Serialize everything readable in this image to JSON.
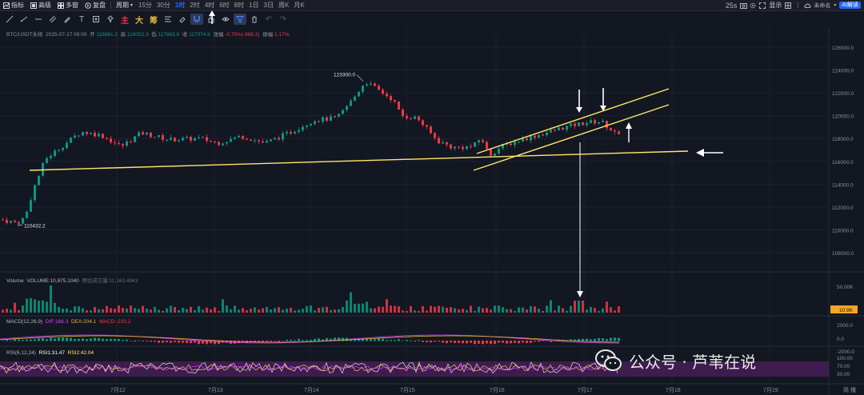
{
  "toolbar": {
    "indicators": "指标",
    "advanced": "高级",
    "multi_chart": "多窗",
    "replay": "复盘",
    "period": "周期",
    "timeframes": [
      "15分",
      "30分",
      "1时",
      "2时",
      "4时",
      "6时",
      "8时",
      "1日",
      "3日",
      "周K",
      "月K"
    ],
    "active_timeframe_index": 2,
    "countdown": "25s",
    "display": "显示",
    "user": "未命名",
    "ai_button": "AI解读"
  },
  "drawing_tools": {
    "cn_main": "主",
    "cn_big": "大",
    "cn_chip": "筹"
  },
  "main_legend": {
    "symbol": "BTC/USDT永续",
    "datetime": "2025-07-17 09:00",
    "open_label": "开",
    "open": "118861.2",
    "high_label": "高",
    "high": "119052.3",
    "low_label": "低",
    "low": "117863.6",
    "close_label": "收",
    "close": "117974.9",
    "change_label": "涨幅",
    "change": "-0.75%(-886.3)",
    "amplitude_label": "振幅",
    "amplitude": "1.17%"
  },
  "volume_legend": {
    "label": "Volume",
    "value": "VOLUME:10,875.1040",
    "ma_label": "预估成交量:11,163.4943",
    "axis_label": "50.00K",
    "current_badge": "10.9K"
  },
  "macd_legend": {
    "label": "MACD(12,26,9)",
    "dif": "DIF:166.3",
    "dea": "DEA:204.1",
    "macd": "MACD:-230.2",
    "axis": [
      "2000.0",
      "0.0",
      "-2000.0"
    ]
  },
  "rsi_legend": {
    "label": "RSI(6,12,24)",
    "rsi1": "RSI1:31.47",
    "rsi2": "RSI2:42.04",
    "axis": [
      "100.00",
      "70.00",
      "30.00"
    ]
  },
  "annotations": {
    "high_label": "123300.0",
    "low_label": "110432.2"
  },
  "colors": {
    "up": "#089981",
    "down": "#f23645",
    "trendline": "#ffe766",
    "bg": "#131722",
    "accent": "#2962ff"
  },
  "watermark": {
    "text": "公众号 · 芦苇在说"
  },
  "chart_data": {
    "type": "candlestick",
    "price_axis": [
      "126000.0",
      "124000.0",
      "122000.0",
      "120000.0",
      "118000.0",
      "116000.0",
      "114000.0",
      "112000.0",
      "110000.0",
      "108000.0"
    ],
    "ylim": [
      106000,
      127000
    ],
    "x_ticks": [
      "7月12",
      "7月13",
      "7月14",
      "7月15",
      "7月16",
      "7月17",
      "7月18",
      "7月19"
    ],
    "annotated_high": 123300.0,
    "annotated_low": 110432.2,
    "candles_end_day": "7月17",
    "corner_label": "简 播"
  }
}
